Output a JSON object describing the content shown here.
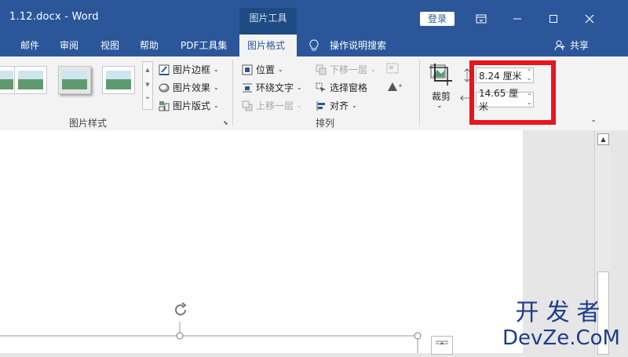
{
  "window": {
    "title": "1.12.docx  -  Word",
    "context_group": "图片工具",
    "login_label": "登录"
  },
  "tabs": [
    "邮件",
    "审阅",
    "视图",
    "帮助",
    "PDF工具集",
    "图片格式"
  ],
  "tell_me": "操作说明搜索",
  "share": "共享",
  "styles_group": {
    "label": "图片样式",
    "border": "图片边框",
    "effects": "图片效果",
    "layout": "图片版式"
  },
  "arrange_group": {
    "label": "排列",
    "position": "位置",
    "wrap": "环绕文字",
    "bring_forward": "上移一层",
    "send_backward": "下移一层",
    "selection_pane": "选择窗格",
    "align": "对齐"
  },
  "size_group": {
    "crop": "裁剪",
    "height": "8.24 厘米",
    "width": "14.65 厘米"
  },
  "watermark": {
    "line1": "开发者",
    "line2": "DevZe.CoM"
  },
  "colors": {
    "title_bar": "#2b579a",
    "highlight": "#e8141e"
  }
}
